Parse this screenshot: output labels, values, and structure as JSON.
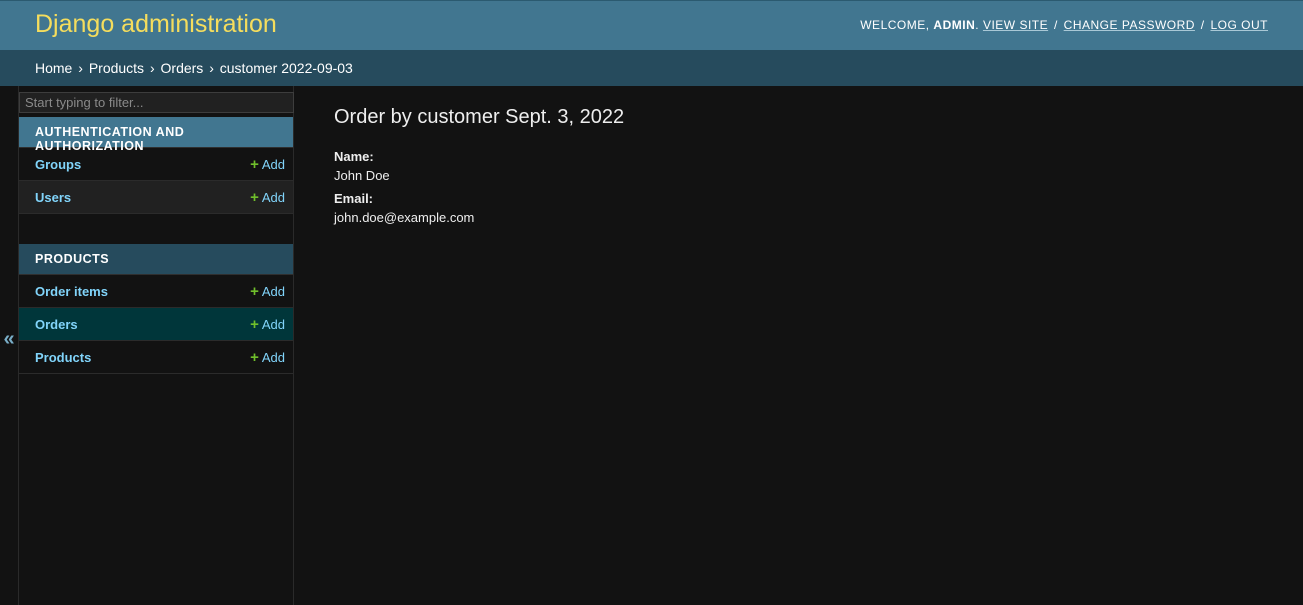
{
  "header": {
    "title": "Django administration",
    "welcome": "WELCOME,",
    "username": "ADMIN",
    "username_period": ".",
    "view_site": "VIEW SITE",
    "change_password": "CHANGE PASSWORD",
    "log_out": "LOG OUT",
    "sep": "/"
  },
  "breadcrumbs": {
    "items": [
      "Home",
      "Products",
      "Orders",
      "customer 2022-09-03"
    ],
    "arrow": "›"
  },
  "sidebar": {
    "toggle": "«",
    "filter_placeholder": "Start typing to filter...",
    "add_label": "Add",
    "apps": [
      {
        "name": "AUTHENTICATION AND AUTHORIZATION",
        "models": [
          "Groups",
          "Users"
        ]
      },
      {
        "name": "PRODUCTS",
        "models": [
          "Order items",
          "Orders",
          "Products"
        ]
      }
    ]
  },
  "content": {
    "title": "Order by customer Sept. 3, 2022",
    "fields": [
      {
        "label": "Name:",
        "value": "John Doe"
      },
      {
        "label": "Email:",
        "value": "john.doe@example.com"
      }
    ]
  },
  "colors": {
    "header_bg": "#417690",
    "breadcrumbs_bg": "#264b5d",
    "brand": "#f5dd5d",
    "link": "#81d4fa",
    "add_plus": "#70bf2b",
    "current_row": "#00363a"
  }
}
